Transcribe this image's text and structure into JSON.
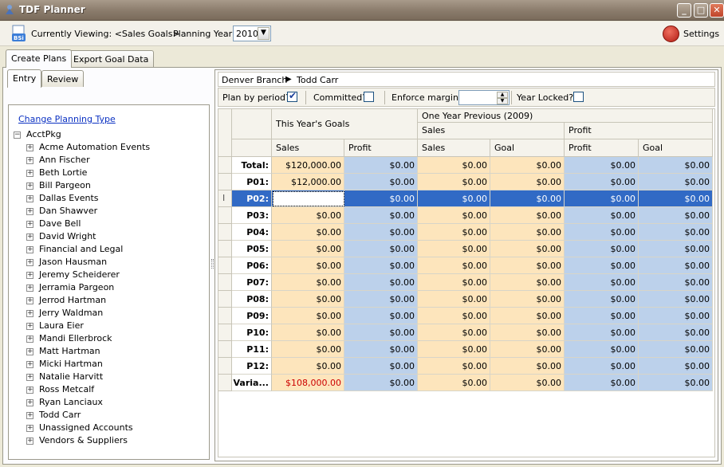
{
  "window": {
    "title": "TDF Planner",
    "min_glyph": "_",
    "max_glyph": "□",
    "close_glyph": "✕"
  },
  "toolbar": {
    "viewing_label": "Currently Viewing: <Sales Goals>",
    "year_label": "Planning Year:",
    "year_value": "2010",
    "settings_label": "Settings"
  },
  "main_tabs": [
    {
      "label": "Create Plans"
    },
    {
      "label": "Export Goal Data"
    }
  ],
  "sub_tabs": [
    {
      "label": "Entry"
    },
    {
      "label": "Review"
    }
  ],
  "change_link": "Change Planning Type",
  "tree": {
    "root": "AcctPkg",
    "items": [
      "Acme Automation Events",
      "Ann Fischer",
      "Beth Lortie",
      "Bill Pargeon",
      "Dallas Events",
      "Dan Shawver",
      "Dave Bell",
      "David Wright",
      "Financial and Legal",
      "Jason Hausman",
      "Jeremy Scheiderer",
      "Jerramia Pargeon",
      "Jerrod Hartman",
      "Jerry Waldman",
      "Laura Eier",
      "Mandi Ellerbrock",
      "Matt Hartman",
      "Micki Hartman",
      "Natalie Harvitt",
      "Ross Metcalf",
      "Ryan Lanciaux",
      "Todd Carr",
      "Unassigned Accounts",
      "Vendors & Suppliers"
    ]
  },
  "breadcrumb": {
    "branch": "Denver Branch",
    "arrow": "▶",
    "person": "Todd Carr"
  },
  "options": {
    "plan_by_period": "Plan by period?",
    "committed": "Committed?",
    "enforce_margin": "Enforce margin?",
    "year_locked": "Year Locked?",
    "check_mark": "✔"
  },
  "grid": {
    "header_this_year": "This Year's Goals",
    "header_prev": "One Year Previous (2009)",
    "header_prev_sales": "Sales",
    "header_prev_profit": "Profit",
    "col_sales": "Sales",
    "col_profit": "Profit",
    "col_prev_sales": "Sales",
    "col_prev_sales_goal": "Goal",
    "col_prev_profit": "Profit",
    "col_prev_profit_goal": "Goal",
    "row_cursor": "I",
    "rows": [
      {
        "label": "Total:",
        "values": [
          "$120,000.00",
          "$0.00",
          "$0.00",
          "$0.00",
          "$0.00",
          "$0.00"
        ]
      },
      {
        "label": "P01:",
        "values": [
          "$12,000.00",
          "$0.00",
          "$0.00",
          "$0.00",
          "$0.00",
          "$0.00"
        ]
      },
      {
        "label": "P02:",
        "values": [
          "",
          "$0.00",
          "$0.00",
          "$0.00",
          "$0.00",
          "$0.00"
        ]
      },
      {
        "label": "P03:",
        "values": [
          "$0.00",
          "$0.00",
          "$0.00",
          "$0.00",
          "$0.00",
          "$0.00"
        ]
      },
      {
        "label": "P04:",
        "values": [
          "$0.00",
          "$0.00",
          "$0.00",
          "$0.00",
          "$0.00",
          "$0.00"
        ]
      },
      {
        "label": "P05:",
        "values": [
          "$0.00",
          "$0.00",
          "$0.00",
          "$0.00",
          "$0.00",
          "$0.00"
        ]
      },
      {
        "label": "P06:",
        "values": [
          "$0.00",
          "$0.00",
          "$0.00",
          "$0.00",
          "$0.00",
          "$0.00"
        ]
      },
      {
        "label": "P07:",
        "values": [
          "$0.00",
          "$0.00",
          "$0.00",
          "$0.00",
          "$0.00",
          "$0.00"
        ]
      },
      {
        "label": "P08:",
        "values": [
          "$0.00",
          "$0.00",
          "$0.00",
          "$0.00",
          "$0.00",
          "$0.00"
        ]
      },
      {
        "label": "P09:",
        "values": [
          "$0.00",
          "$0.00",
          "$0.00",
          "$0.00",
          "$0.00",
          "$0.00"
        ]
      },
      {
        "label": "P10:",
        "values": [
          "$0.00",
          "$0.00",
          "$0.00",
          "$0.00",
          "$0.00",
          "$0.00"
        ]
      },
      {
        "label": "P11:",
        "values": [
          "$0.00",
          "$0.00",
          "$0.00",
          "$0.00",
          "$0.00",
          "$0.00"
        ]
      },
      {
        "label": "P12:",
        "values": [
          "$0.00",
          "$0.00",
          "$0.00",
          "$0.00",
          "$0.00",
          "$0.00"
        ]
      },
      {
        "label": "Varia...",
        "values": [
          "$108,000.00",
          "$0.00",
          "$0.00",
          "$0.00",
          "$0.00",
          "$0.00"
        ]
      }
    ]
  },
  "colors": {
    "goal_cell": "#fde5bc",
    "prev_cell": "#bcd1eb",
    "selected_row": "#316ac5",
    "negative": "#cc0000"
  }
}
